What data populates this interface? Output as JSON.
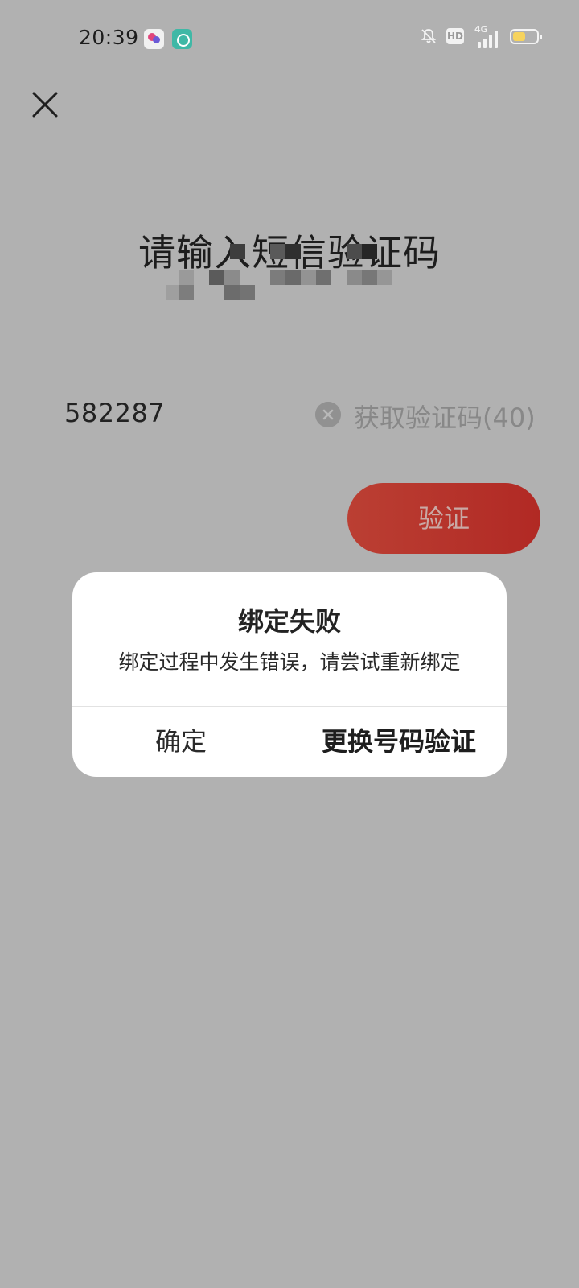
{
  "status_bar": {
    "time": "20:39",
    "network": "4G",
    "hd": "HD",
    "battery_level": 0.55,
    "icons": [
      "app-notification-icon",
      "app-chat-icon",
      "mute-bell-icon",
      "hd-icon",
      "signal-icon",
      "battery-icon"
    ]
  },
  "page": {
    "close_icon": "close-icon",
    "title": "请输入短信验证码",
    "code_value": "582287",
    "get_code_label": "获取验证码(40)",
    "verify_label": "验证"
  },
  "dialog": {
    "title": "绑定失败",
    "message": "绑定过程中发生错误，请尝试重新绑定",
    "confirm_label": "确定",
    "change_number_label": "更换号码验证"
  },
  "colors": {
    "overlay_bg": "#b1b1b1",
    "verify_button": "#b12924",
    "battery_fill": "#f6d35d"
  }
}
